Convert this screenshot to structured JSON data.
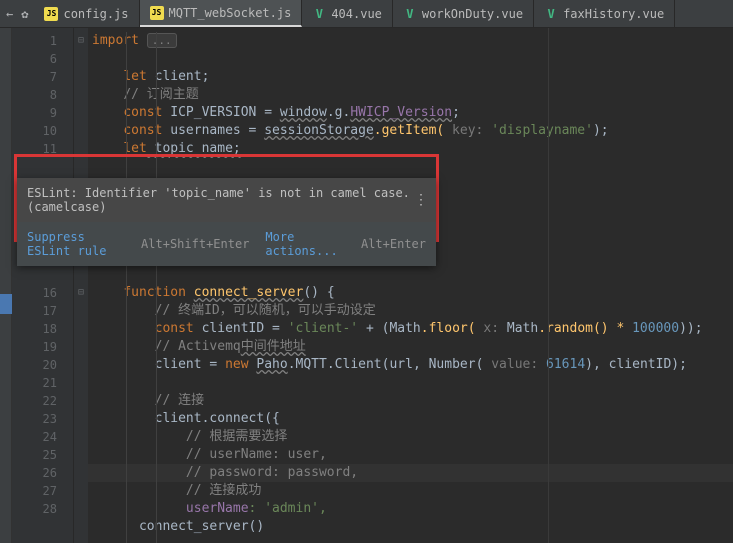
{
  "tabs": {
    "config": "config.js",
    "mqtt": "MQTT_webSocket.js",
    "v404": "404.vue",
    "workonduty": "workOnDuty.vue",
    "faxhistory": "faxHistory.vue"
  },
  "lines": {
    "n1": "1",
    "n6": "6",
    "n7": "7",
    "n8": "8",
    "n9": "9",
    "n10": "10",
    "n11": "11",
    "n16": "16",
    "n17": "17",
    "n18": "18",
    "n19": "19",
    "n20": "20",
    "n21": "21",
    "n22": "22",
    "n23": "23",
    "n24": "24",
    "n25": "25",
    "n26": "26",
    "n27": "27",
    "n28": "28"
  },
  "code": {
    "import": "import ",
    "ellipsis": "...",
    "let": "let",
    "const": "const",
    "new": "new",
    "function": "function",
    "client": " client;",
    "sub_comment": "// 订阅主题",
    "icp": " ICP_VERSION = ",
    "window": "window",
    "g": ".g.",
    "hwicp": "HWICP_Version",
    "semi": ";",
    "usernames": " usernames = ",
    "sessionStorage": "sessionStorage",
    "getItem": ".getItem(",
    "keyhint": " key: ",
    "displayname": "'displayname'",
    "close": ");",
    "topic_name": " topic_name;",
    "connect_server": "connect_server",
    "empty_args": "() {",
    "term_comment": "// 终端ID，可以随机，可以手动设定",
    "clientID": " clientID = ",
    "clientdash": "'client-'",
    "plus": " + (",
    "math": "Math",
    "floor": ".floor(",
    "xhint": " x: ",
    "random": ".random() * ",
    "hundred_k": "100000",
    "double_close": "));",
    "activemq_comment": "// Activemq",
    "activemq_cn": "中间件地址",
    "client_eq": "client = ",
    "paho": "Paho",
    "mqtt": ".MQTT.",
    "Client": "Client",
    "open": "(url, ",
    "Number": "Number",
    "open2": "(",
    "valuehint": " value: ",
    "portnum": "61614",
    "close2": "), clientID);",
    "connect_comment": "// 连接",
    "connect": "client.connect({",
    "need_comment": "// 根据需要选择",
    "username_comment": "// userName: user,",
    "password_comment": "// password: password,",
    "success_comment": "// 连接成功",
    "userName": "userName",
    "admin": ": 'admin',",
    "connect_call": "connect_server()"
  },
  "popup": {
    "message": "ESLint: Identifier 'topic_name' is not in camel case. (camelcase)",
    "suppress": "Suppress ESLint rule",
    "suppress_hint": "Alt+Shift+Enter",
    "more": "More actions...",
    "more_hint": "Alt+Enter"
  }
}
